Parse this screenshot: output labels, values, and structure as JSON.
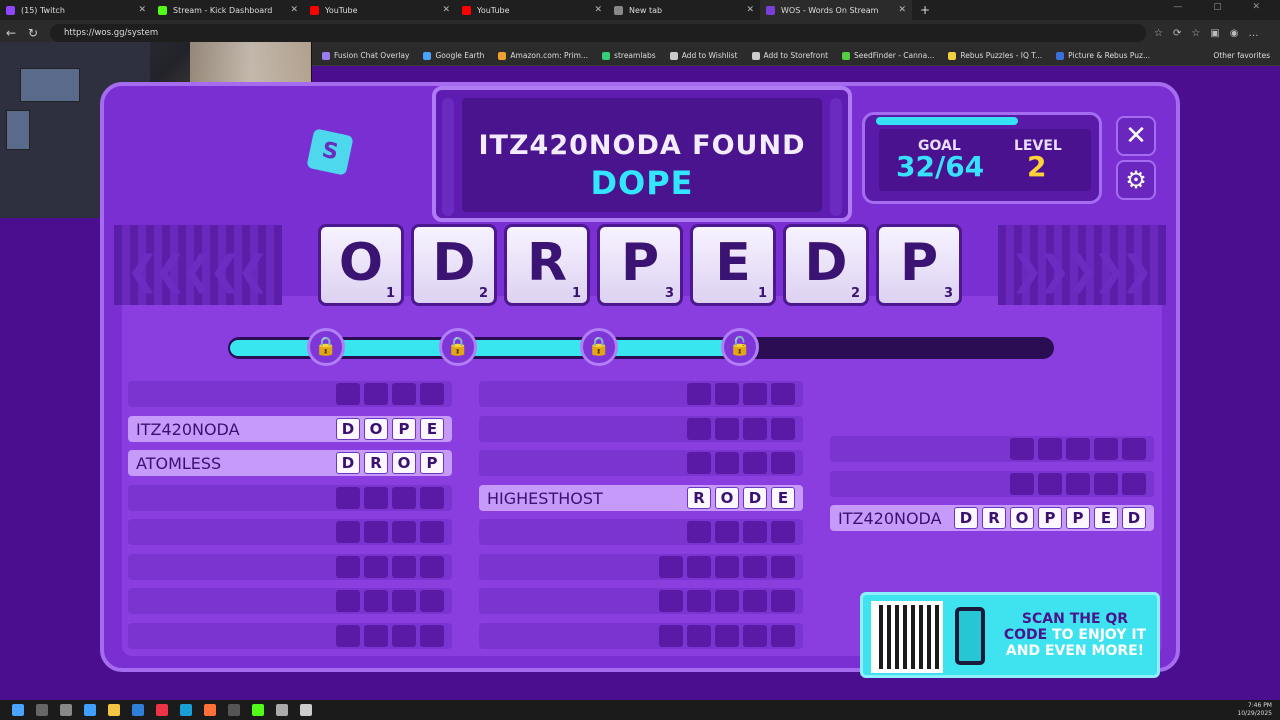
{
  "browser": {
    "tabs": [
      {
        "title": "(15) Twitch",
        "color": "#9146ff",
        "active": false
      },
      {
        "title": "Stream - Kick Dashboard",
        "color": "#53fc18",
        "active": false
      },
      {
        "title": "YouTube",
        "color": "#ff0000",
        "active": false
      },
      {
        "title": "YouTube",
        "color": "#ff0000",
        "active": false
      },
      {
        "title": "New tab",
        "color": "#888888",
        "active": false
      },
      {
        "title": "WOS - Words On Stream",
        "color": "#7a3fd8",
        "active": true
      }
    ],
    "url": "https://wos.gg/system",
    "bookmarks": [
      "Fusion Chat Overlay",
      "Google Earth",
      "Amazon.com: Prim...",
      "streamlabs",
      "Add to Wishlist",
      "Add to Storefront",
      "SeedFinder - Canna...",
      "Rebus Puzzles - IQ T...",
      "Picture & Rebus Puz..."
    ],
    "other_favorites": "Other favorites"
  },
  "game": {
    "found_line": "ITZ420NODA FOUND",
    "found_word": "DOPE",
    "goal_label": "GOAL",
    "goal_value": "32/64",
    "level_label": "LEVEL",
    "level_value": "2",
    "close_glyph": "✕",
    "settings_glyph": "⚙",
    "logo_letter": "S",
    "tiles": [
      {
        "letter": "O",
        "score": "1"
      },
      {
        "letter": "D",
        "score": "2"
      },
      {
        "letter": "R",
        "score": "1"
      },
      {
        "letter": "P",
        "score": "3"
      },
      {
        "letter": "E",
        "score": "1"
      },
      {
        "letter": "D",
        "score": "2"
      },
      {
        "letter": "P",
        "score": "3"
      }
    ],
    "progress_fraction": 0.62,
    "locks": [
      "🔒",
      "🔒",
      "🔒",
      "🔓"
    ],
    "col1": [
      {
        "name": "",
        "letters": [
          "",
          "",
          "",
          ""
        ]
      },
      {
        "name": "ITZ420NODA",
        "letters": [
          "D",
          "O",
          "P",
          "E"
        ]
      },
      {
        "name": "ATOMLESS",
        "letters": [
          "D",
          "R",
          "O",
          "P"
        ]
      },
      {
        "name": "",
        "letters": [
          "",
          "",
          "",
          ""
        ]
      },
      {
        "name": "",
        "letters": [
          "",
          "",
          "",
          ""
        ]
      },
      {
        "name": "",
        "letters": [
          "",
          "",
          "",
          ""
        ]
      },
      {
        "name": "",
        "letters": [
          "",
          "",
          "",
          ""
        ]
      },
      {
        "name": "",
        "letters": [
          "",
          "",
          "",
          ""
        ]
      }
    ],
    "col2": [
      {
        "name": "",
        "letters": [
          "",
          "",
          "",
          ""
        ]
      },
      {
        "name": "",
        "letters": [
          "",
          "",
          "",
          ""
        ]
      },
      {
        "name": "",
        "letters": [
          "",
          "",
          "",
          ""
        ]
      },
      {
        "name": "HIGHESTHOST",
        "letters": [
          "R",
          "O",
          "D",
          "E"
        ]
      },
      {
        "name": "",
        "letters": [
          "",
          "",
          "",
          ""
        ]
      },
      {
        "name": "",
        "letters": [
          "",
          "",
          "",
          "",
          ""
        ]
      },
      {
        "name": "",
        "letters": [
          "",
          "",
          "",
          "",
          ""
        ]
      },
      {
        "name": "",
        "letters": [
          "",
          "",
          "",
          "",
          ""
        ]
      }
    ],
    "col3": [
      {
        "name": "",
        "letters": [
          "",
          "",
          "",
          "",
          ""
        ]
      },
      {
        "name": "",
        "letters": [
          "",
          "",
          "",
          "",
          ""
        ]
      },
      {
        "name": "ITZ420NODA",
        "letters": [
          "D",
          "R",
          "O",
          "P",
          "P",
          "E",
          "D"
        ]
      }
    ],
    "qr": {
      "line1": "SCAN THE QR",
      "line2a": "CODE ",
      "line2b": "TO ENJOY IT",
      "line3": "AND EVEN MORE!"
    }
  },
  "taskbar": {
    "time": "7:46 PM",
    "date": "10/29/2025"
  }
}
